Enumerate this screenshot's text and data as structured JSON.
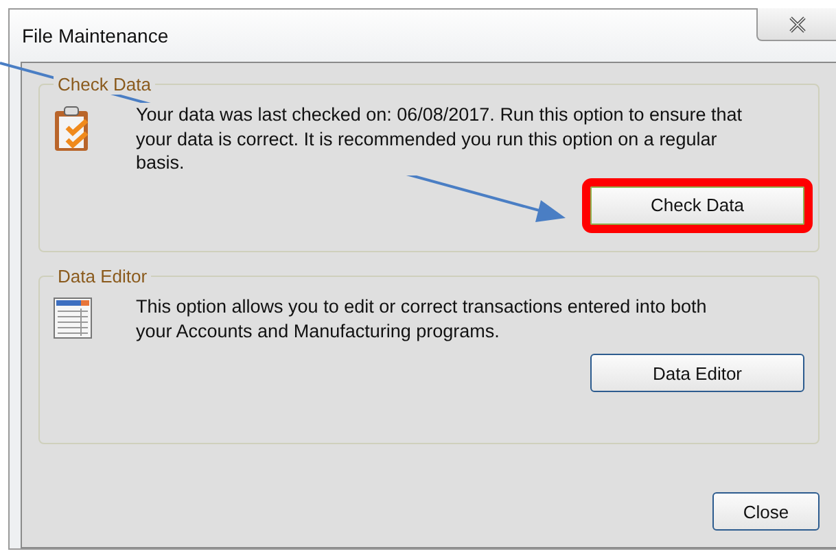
{
  "window": {
    "title": "File Maintenance"
  },
  "groups": [
    {
      "title": "Check Data",
      "kind": "check",
      "text": "Your data was last checked on: 06/08/2017.  Run this option to ensure that your data is correct.  It is recommended you run this option on a regular basis.",
      "button": {
        "label": "Check Data",
        "highlighted": true
      }
    },
    {
      "title": "Data Editor",
      "kind": "editor",
      "text": "This option allows you to edit or correct transactions entered into both your Accounts and Manufacturing programs.",
      "button": {
        "label": "Data Editor",
        "highlighted": false
      }
    }
  ],
  "close_button": "Close",
  "callout_arrow": true
}
